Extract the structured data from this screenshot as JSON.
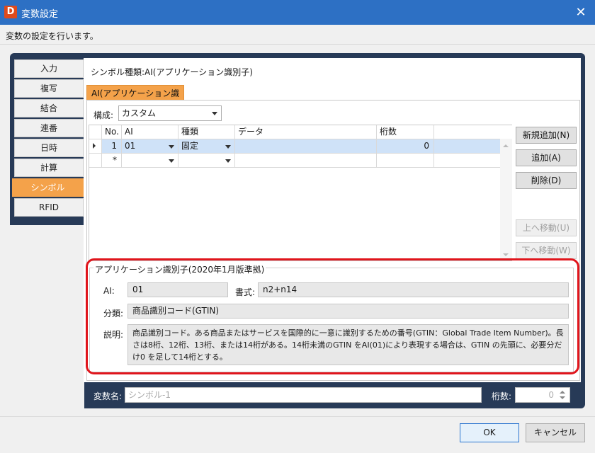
{
  "window": {
    "title": "変数設定",
    "app_icon_letter": "D",
    "close_label": "✕",
    "description": "変数の設定を行います。"
  },
  "side_tabs": [
    {
      "label": "入力",
      "active": false
    },
    {
      "label": "複写",
      "active": false
    },
    {
      "label": "結合",
      "active": false
    },
    {
      "label": "連番",
      "active": false
    },
    {
      "label": "日時",
      "active": false
    },
    {
      "label": "計算",
      "active": false
    },
    {
      "label": "シンボル",
      "active": true
    },
    {
      "label": "RFID",
      "active": false
    }
  ],
  "symbol_type": "シンボル種類:AI(アプリケーション識別子)",
  "inner_tab_label": "AI(アプリケーション識別子)",
  "config": {
    "label": "構成:",
    "value": "カスタム"
  },
  "grid": {
    "headers": [
      "No.",
      "AI",
      "種類",
      "データ",
      "桁数"
    ],
    "rows": [
      {
        "pointer": "▶",
        "no": "1",
        "ai": "01",
        "kind": "固定",
        "data": "",
        "digits": "0"
      },
      {
        "pointer": "",
        "no": "*",
        "ai": "",
        "kind": "",
        "data": "",
        "digits": ""
      }
    ]
  },
  "buttons": {
    "new_add": "新規追加(N)",
    "add": "追加(A)",
    "delete": "削除(D)",
    "move_up": "上へ移動(U)",
    "move_down": "下へ移動(W)"
  },
  "ai_info": {
    "legend": "アプリケーション識別子(2020年1月版準拠)",
    "ai_label": "AI:",
    "ai_value": "01",
    "format_label": "書式:",
    "format_value": "n2+n14",
    "category_label": "分類:",
    "category_value": "商品識別コード(GTIN)",
    "desc_label": "説明:",
    "desc_value": "商品識別コード。ある商品またはサービスを国際的に一意に識別するための番号(GTIN：Global Trade Item Number)。長さは8桁、12桁、13桁、または14桁がある。14桁未満のGTIN をAI(01)により表現する場合は、GTIN の先頭に、必要分だけ0 を足して14桁とする。"
  },
  "variable": {
    "name_label": "変数名:",
    "name_placeholder": "シンボル-1",
    "digits_label": "桁数:",
    "digits_value": "0"
  },
  "dialog_buttons": {
    "ok": "OK",
    "cancel": "キャンセル"
  },
  "colors": {
    "titlebar": "#2d70c4",
    "panel_dark": "#273a57",
    "accent_orange": "#f4a24a",
    "highlight_red": "#e0151c",
    "row_selected": "#cfe2f8"
  }
}
